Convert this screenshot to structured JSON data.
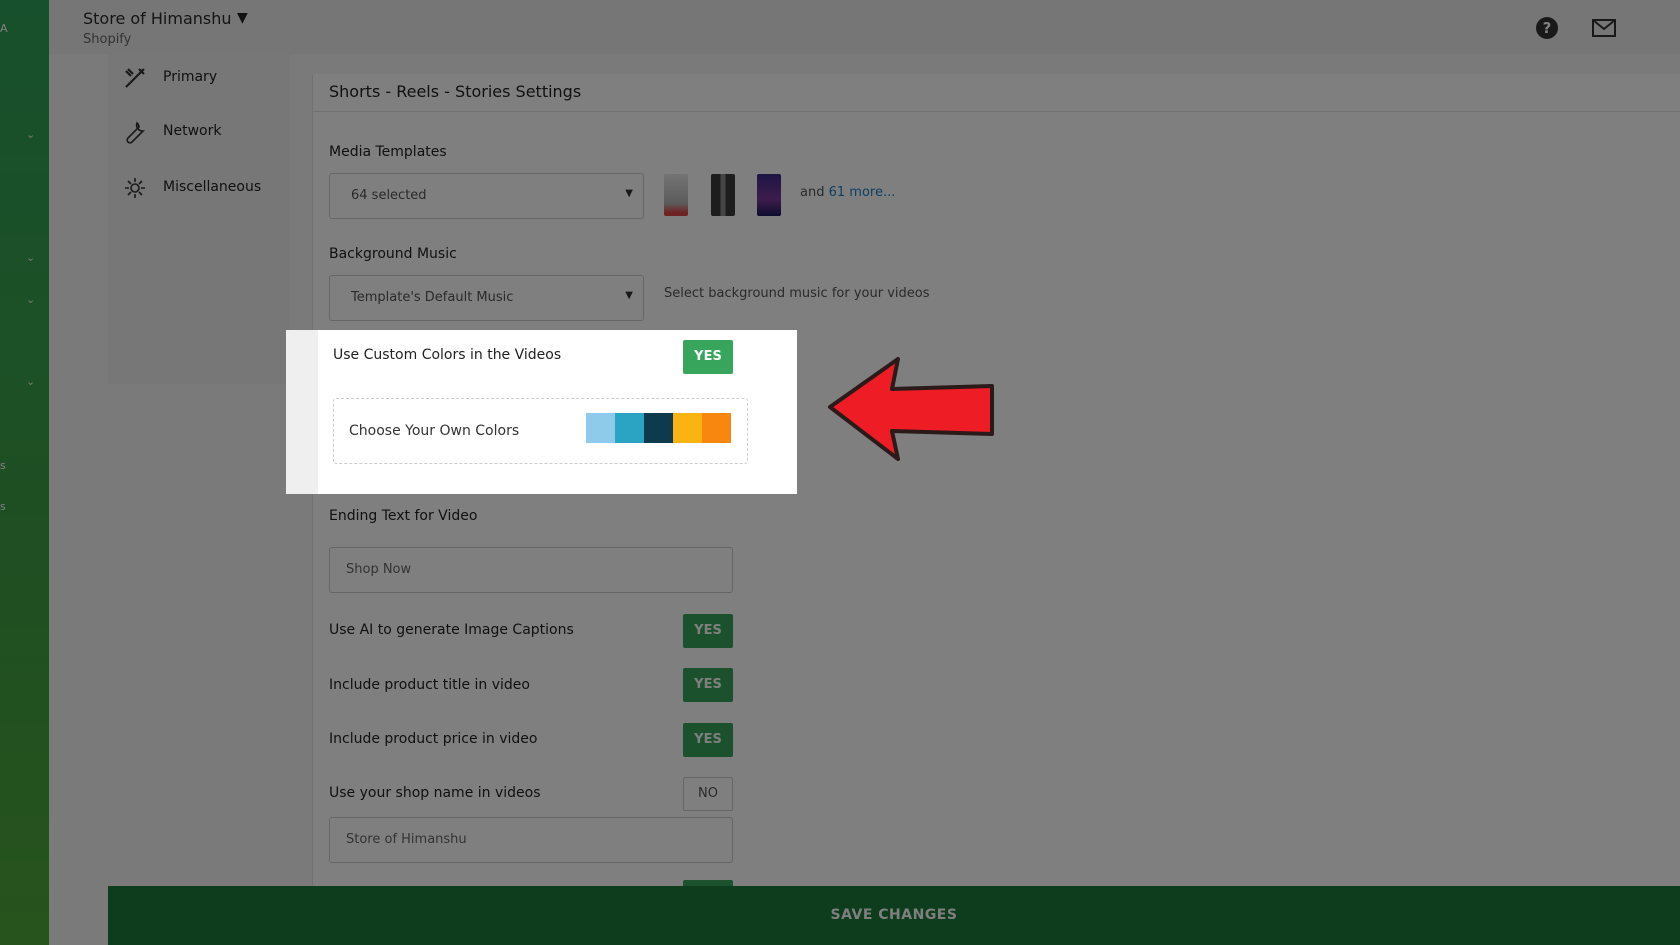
{
  "header": {
    "store_name": "Store of Himanshu",
    "platform": "Shopify",
    "icons": [
      "help-icon",
      "mail-icon"
    ]
  },
  "sidebar": {
    "items": [
      {
        "label": "Primary",
        "icon": "tools-icon"
      },
      {
        "label": "Network",
        "icon": "wrench-icon"
      },
      {
        "label": "Miscellaneous",
        "icon": "gear-icon"
      }
    ]
  },
  "main": {
    "title": "Shorts - Reels - Stories Settings",
    "media_templates": {
      "label": "Media Templates",
      "value": "64 selected",
      "more_prefix": "and",
      "more_link": "61 more..."
    },
    "background_music": {
      "label": "Background Music",
      "value": "Template's Default Music",
      "helper": "Select background music for your videos"
    },
    "custom_colors": {
      "label": "Use Custom Colors in the Videos",
      "toggle": "YES",
      "choose_label": "Choose Your Own Colors",
      "swatches": [
        "#8ecbea",
        "#2ba4c4",
        "#0d3a4c",
        "#f9b312",
        "#f7870f"
      ]
    },
    "ending_text": {
      "label": "Ending Text for Video",
      "value": "Shop Now"
    },
    "toggles": [
      {
        "label": "Use AI to generate Image Captions",
        "value": "YES"
      },
      {
        "label": "Include product title in video",
        "value": "YES"
      },
      {
        "label": "Include product price in video",
        "value": "YES"
      },
      {
        "label": "Use your shop name in videos",
        "value": "NO"
      }
    ],
    "shop_name_value": "Store of  Himanshu"
  },
  "save_button": "SAVE CHANGES",
  "colors": {
    "accent_green": "#37a55b",
    "save_bar": "#1b7a39",
    "annotation_arrow": "#ee1c25"
  }
}
